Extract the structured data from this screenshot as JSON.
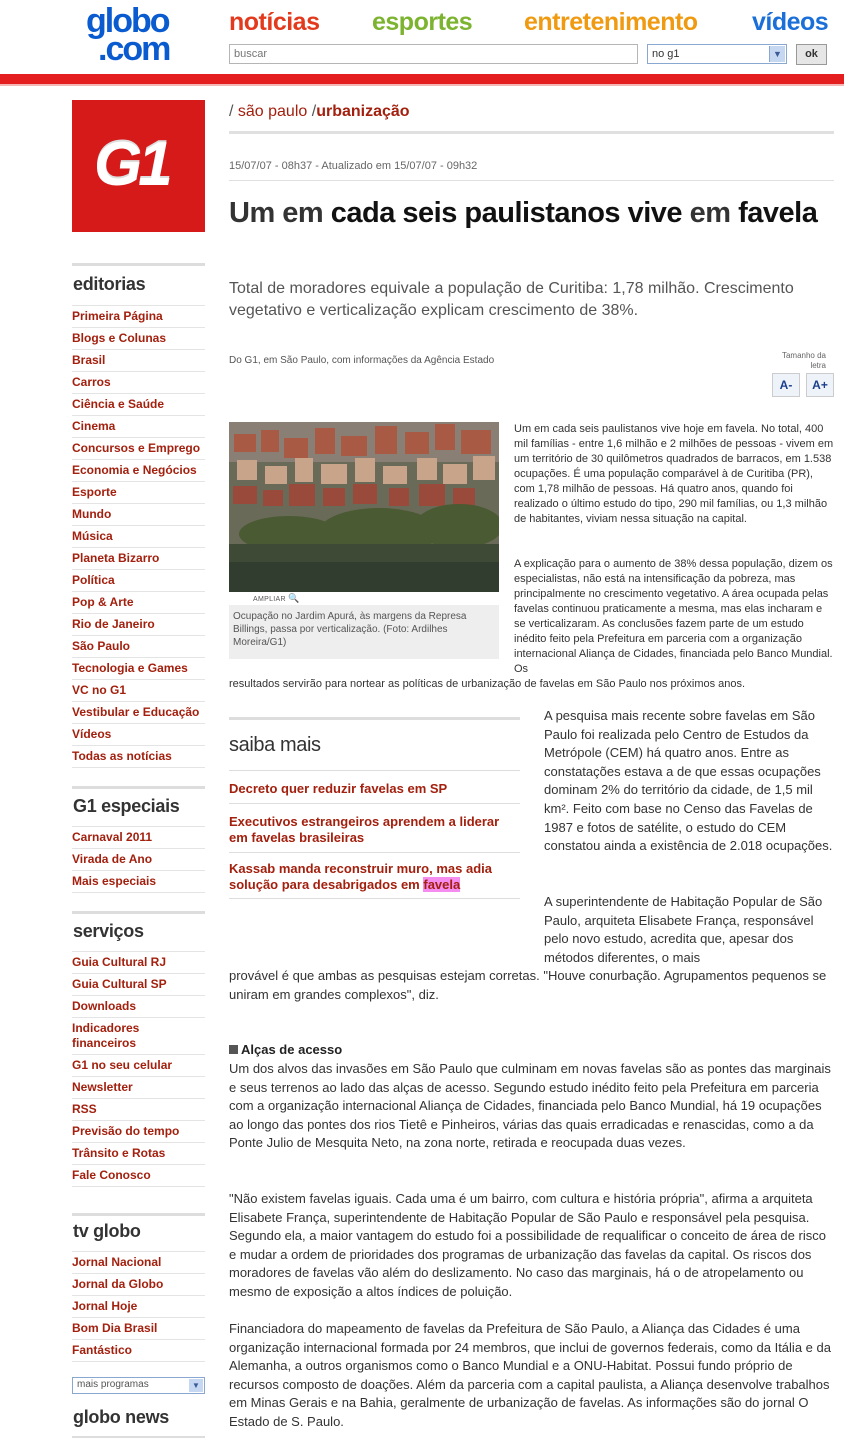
{
  "header": {
    "logo_line1": "globo",
    "logo_line2": ".com",
    "nav": [
      "notícias",
      "esportes",
      "entretenimento",
      "vídeos"
    ],
    "search_placeholder": "buscar",
    "scope_selected": "no g1",
    "ok_label": "ok"
  },
  "sidebar": {
    "g1_logo": "G1",
    "editorias_title": "editorias",
    "editorias": [
      "Primeira Página",
      "Blogs e Colunas",
      "Brasil",
      "Carros",
      "Ciência e Saúde",
      "Cinema",
      "Concursos e Emprego",
      "Economia e Negócios",
      "Esporte",
      "Mundo",
      "Música",
      "Planeta Bizarro",
      "Política",
      "Pop & Arte",
      "Rio de Janeiro",
      "São Paulo",
      "Tecnologia e Games",
      "VC no G1",
      "Vestibular e Educação",
      "Vídeos",
      "Todas as notícias"
    ],
    "especiais_title": "G1 especiais",
    "especiais": [
      "Carnaval 2011",
      "Virada de Ano",
      "Mais especiais"
    ],
    "servicos_title": "serviços",
    "servicos": [
      "Guia Cultural RJ",
      "Guia Cultural SP",
      "Downloads",
      "Indicadores financeiros",
      "G1 no seu celular",
      "Newsletter",
      "RSS",
      "Previsão do tempo",
      "Trânsito e Rotas",
      "Fale Conosco"
    ],
    "tvglobo_title": "tv globo",
    "tvglobo": [
      "Jornal Nacional",
      "Jornal da Globo",
      "Jornal Hoje",
      "Bom Dia Brasil",
      "Fantástico"
    ],
    "programas_select": "mais programas",
    "globonews_title": "globo news"
  },
  "article": {
    "breadcrumb_section": "são paulo",
    "breadcrumb_current": "urbanização",
    "dateline": "15/07/07 - 08h37 - Atualizado em 15/07/07 - 09h32",
    "headline_a": "Um em ",
    "headline_b": "cada seis paulistanos vive",
    "headline_c": " em ",
    "headline_d": "favela",
    "subhead": "Total de moradores equivale a população de Curitiba: 1,78 milhão. Crescimento vegetativo e verticalização explicam crescimento de 38%.",
    "byline": "Do G1, em São Paulo, com informações da Agência Estado",
    "fontsize_label": "Tamanho da letra",
    "font_minus": "A-",
    "font_plus": "A+",
    "ampliar": "AMPLIAR",
    "caption": "Ocupação no Jardim Apurá, às margens da Represa Billings, passa por verticalização. (Foto: Ardilhes Moreira/G1)",
    "p1": "Um em cada seis paulistanos vive hoje em favela. No total, 400 mil famílias - entre 1,6 milhão e 2 milhões de pessoas - vivem em um território de 30 quilômetros quadrados de barracos, em 1.538 ocupações. É uma população comparável à de Curitiba (PR), com 1,78 milhão de pessoas. Há quatro anos, quando foi realizado o último estudo do tipo, 290 mil famílias, ou 1,3 milhão de habitantes, viviam nessa situação na capital.",
    "p2a": "A explicação para o aumento de 38% dessa população, dizem os especialistas, não está na intensificação da pobreza, mas principalmente no crescimento vegetativo. A área ocupada pelas favelas continuou praticamente a mesma, mas elas incharam e se verticalizaram. As conclusões fazem parte de um estudo inédito feito pela Prefeitura em parceria com a organização internacional Aliança de Cidades, financiada pelo Banco Mundial. Os",
    "p2b": "resultados servirão para nortear as políticas de urbanização de favelas em São Paulo nos próximos anos.",
    "saiba_title": "saiba mais",
    "saiba_link1": "Decreto quer reduzir favelas em SP",
    "saiba_link2": "Executivos estrangeiros aprendem a liderar em favelas brasileiras",
    "saiba_link3a": "Kassab manda reconstruir muro, mas adia solução para desabrigados em ",
    "saiba_link3b": "favela",
    "p3": "A pesquisa mais recente sobre favelas em São Paulo foi realizada pelo Centro de Estudos da Metrópole (CEM) há quatro anos. Entre as constatações estava a de que essas ocupações dominam 2% do território da cidade, de 1,5 mil km². Feito com base no Censo das Favelas de 1987 e fotos de satélite, o estudo do CEM constatou ainda a existência de 2.018 ocupações.",
    "p4a": "A superintendente de Habitação Popular de São Paulo, arquiteta Elisabete França, responsável pelo novo estudo, acredita que, apesar dos métodos diferentes, o mais",
    "p4b": "provável é que ambas as pesquisas estejam corretas. \"Houve conurbação. Agrupamentos pequenos se uniram em grandes complexos\", diz.",
    "subhead2": "Alças de acesso",
    "p5": "Um dos alvos das invasões em São Paulo que culminam em novas favelas são as pontes das marginais e seus terrenos ao lado das alças de acesso. Segundo estudo inédito feito pela Prefeitura em parceria com a organização internacional Aliança de Cidades, financiada pelo Banco Mundial, há 19 ocupações ao longo das pontes dos rios Tietê e Pinheiros, várias das quais erradicadas e renascidas, como a da Ponte Julio de Mesquita Neto, na zona norte, retirada e reocupada duas vezes.",
    "p6": "\"Não existem favelas iguais. Cada uma é um bairro, com cultura e história própria\", afirma a arquiteta Elisabete França, superintendente de Habitação Popular de São Paulo e responsável pela pesquisa. Segundo ela, a maior vantagem do estudo foi a possibilidade de requalificar o conceito de área de risco e mudar a ordem de prioridades dos programas de urbanização das favelas da capital. Os riscos dos moradores de favelas vão além do deslizamento. No caso das marginais, há o de atropelamento ou mesmo de exposição a altos índices de poluição.",
    "p7": "Financiadora do mapeamento de favelas da Prefeitura de São Paulo, a Aliança das Cidades é uma organização internacional formada por 24 membros, que inclui de governos federais, como da Itália e da Alemanha, a outros organismos como o Banco Mundial e a ONU-Habitat. Possui fundo próprio de recursos composto de doações. Além da parceria com a capital paulista, a Aliança desenvolve trabalhos em Minas Gerais e na Bahia, geralmente de urbanização de favelas. As informações são do jornal O Estado de S. Paulo."
  }
}
